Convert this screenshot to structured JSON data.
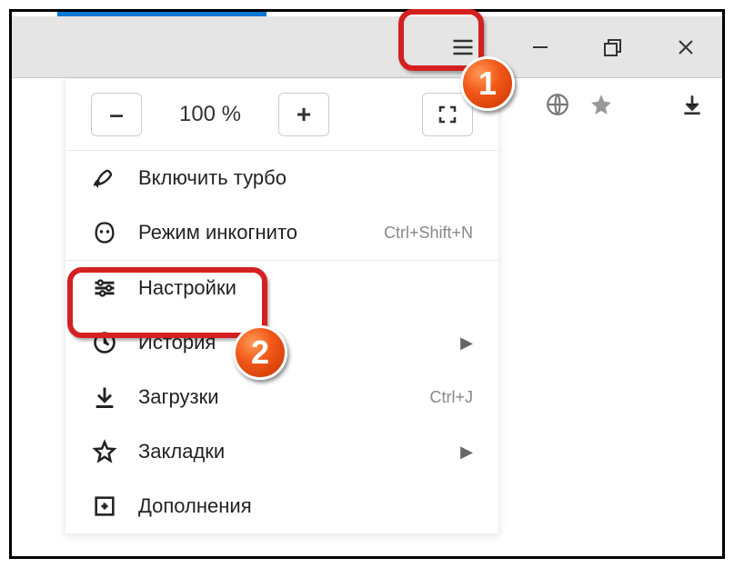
{
  "zoom": {
    "minus": "–",
    "plus": "+",
    "value": "100 %"
  },
  "menu": {
    "turbo": "Включить турбо",
    "incognito": "Режим инкогнито",
    "incognito_shortcut": "Ctrl+Shift+N",
    "settings": "Настройки",
    "history": "История",
    "downloads": "Загрузки",
    "downloads_shortcut": "Ctrl+J",
    "bookmarks": "Закладки",
    "addons": "Дополнения"
  },
  "callouts": {
    "one": "1",
    "two": "2"
  }
}
